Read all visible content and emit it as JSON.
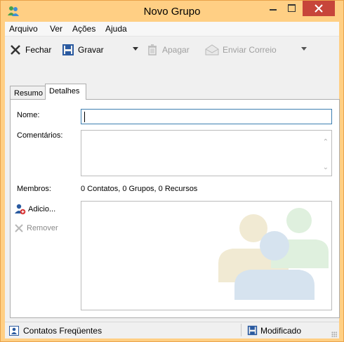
{
  "window": {
    "title": "Novo Grupo",
    "accent": "#ffcf84",
    "close_color": "#c7453a"
  },
  "menubar": {
    "items": [
      "Arquivo",
      "Ver",
      "Ações",
      "Ajuda"
    ]
  },
  "toolbar": {
    "close_label": "Fechar",
    "save_label": "Gravar",
    "delete_label": "Apagar",
    "send_label": "Enviar Correio"
  },
  "tabs": [
    {
      "label": "Resumo",
      "selected": false
    },
    {
      "label": "Detalhes",
      "selected": true
    }
  ],
  "form": {
    "name_label": "Nome:",
    "name_value": "",
    "comments_label": "Comentários:",
    "comments_value": "",
    "members_label": "Membros:",
    "members_value": "0 Contatos, 0 Grupos, 0 Recursos",
    "add_label": "Adicio...",
    "remove_label": "Remover"
  },
  "statusbar": {
    "left_label": "Contatos Freqüentes",
    "right_label": "Modificado"
  },
  "icons": {
    "app": "contacts-app-icon",
    "close": "x-icon",
    "save": "floppy-icon",
    "delete": "trash-icon",
    "send": "envelope-icon",
    "add": "add-person-icon",
    "remove": "x-icon",
    "contacts": "contacts-card-icon",
    "modified": "floppy-icon"
  }
}
